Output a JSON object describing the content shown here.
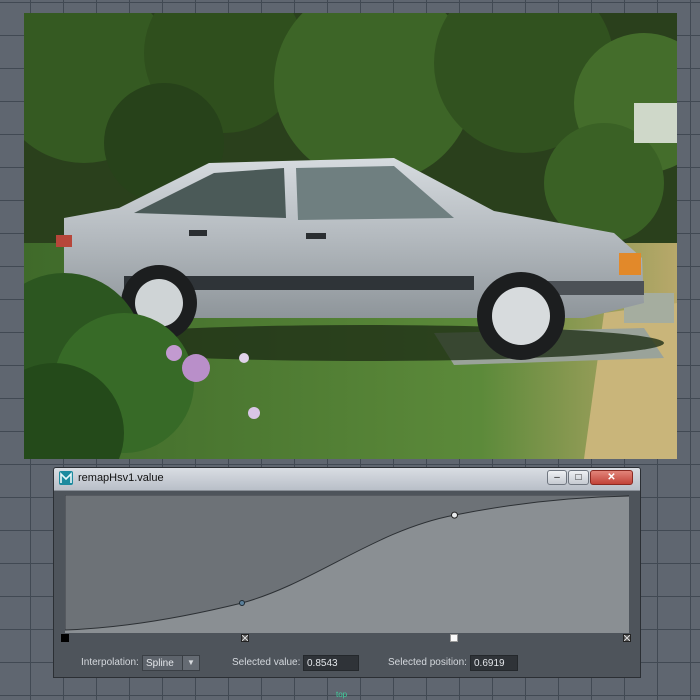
{
  "window": {
    "title": "remapHsv1.value",
    "minimize_symbol": "–",
    "maximize_symbol": "□",
    "close_symbol": "✕"
  },
  "curve": {
    "background_color": "#6d7277",
    "fill_color": "#8a8f93",
    "selected_point": {
      "position": 0.6919,
      "value": 0.8543
    }
  },
  "controls": {
    "interpolation_label": "Interpolation:",
    "interpolation_value": "Spline",
    "selected_value_label": "Selected value:",
    "selected_value": "0.8543",
    "selected_position_label": "Selected position:",
    "selected_position": "0.6919"
  },
  "viewport": {
    "camera_label": "top"
  }
}
